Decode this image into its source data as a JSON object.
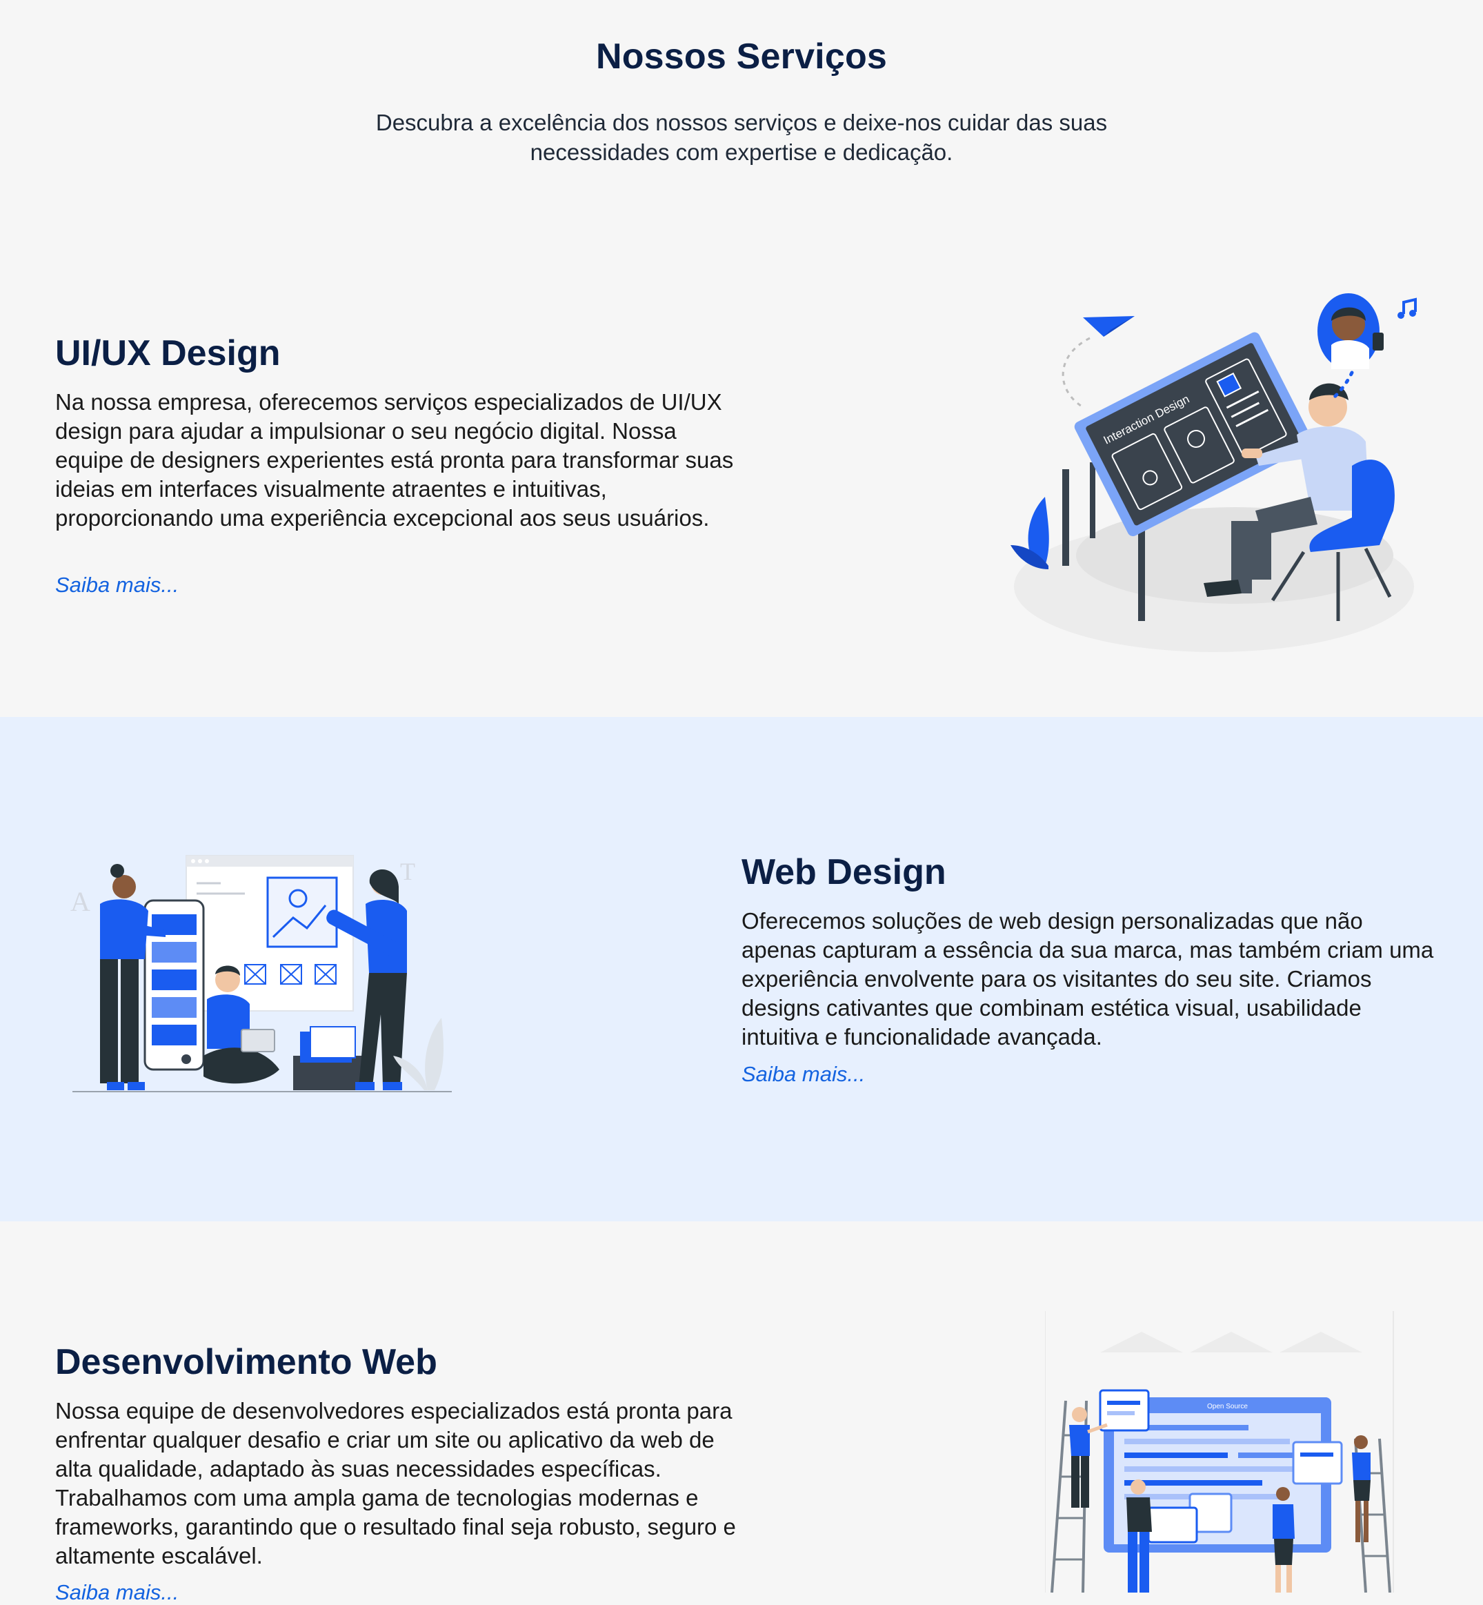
{
  "header": {
    "title": "Nossos Serviços",
    "subtitle": "Descubra a excelência dos nossos serviços e deixe-nos cuidar das suas necessidades com expertise e dedicação."
  },
  "services": [
    {
      "title": "UI/UX Design",
      "text": "Na nossa empresa, oferecemos serviços especializados de UI/UX design para ajudar a impulsionar o seu negócio digital. Nossa equipe de designers experientes está pronta para transformar suas ideias em interfaces visualmente atraentes e intuitivas, proporcionando uma experiência excepcional aos seus usuários.",
      "link": "Saiba mais...",
      "illustration": "interaction-design-illustration",
      "illustration_text": "Interaction Design"
    },
    {
      "title": "Web Design",
      "text": "Oferecemos soluções de web design personalizadas que não apenas capturam a essência da sua marca, mas também criam uma experiência envolvente para os visitantes do seu site. Criamos designs cativantes que combinam estética visual, usabilidade intuitiva e funcionalidade avançada.",
      "link": "Saiba mais...",
      "illustration": "web-design-team-illustration"
    },
    {
      "title": "Desenvolvimento Web",
      "text": "Nossa equipe de desenvolvedores especializados está pronta para enfrentar qualquer desafio e criar um site ou aplicativo da web de alta qualidade, adaptado às suas necessidades específicas. Trabalhamos com uma ampla gama de tecnologias modernas e frameworks, garantindo que o resultado final seja robusto, seguro e altamente escalável.",
      "link": "Saiba mais...",
      "illustration": "open-source-development-illustration",
      "illustration_text": "Open Source"
    }
  ],
  "colors": {
    "page_background": "#f6f6f6",
    "band_background": "#e7f0fe",
    "title": "#0b1f45",
    "link": "#1463e0",
    "accent_blue": "#1a5cf0"
  }
}
